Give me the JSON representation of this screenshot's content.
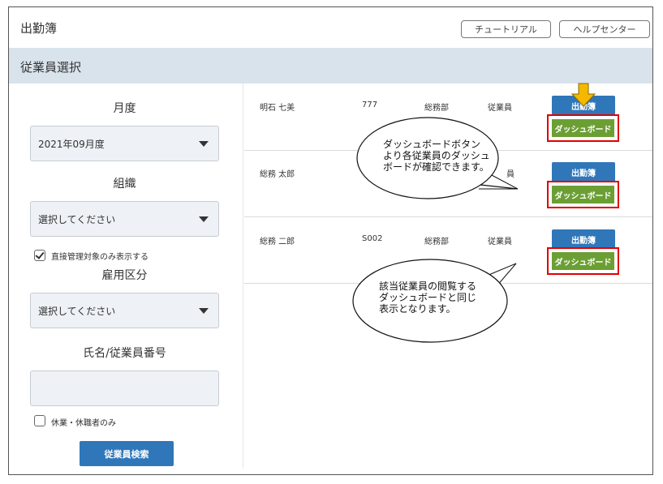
{
  "header": {
    "app_title": "出勤簿",
    "tutorial_label": "チュートリアル",
    "help_label": "ヘルプセンター"
  },
  "section": {
    "title": "従業員選択"
  },
  "filters": {
    "month_label": "月度",
    "month_value": "2021年09月度",
    "org_label": "組織",
    "org_value": "選択してください",
    "direct_only_label": "直接管理対象のみ表示する",
    "direct_only_checked": true,
    "employment_label": "雇用区分",
    "employment_value": "選択してください",
    "name_label": "氏名/従業員番号",
    "name_value": "",
    "leave_only_label": "休業・休職者のみ",
    "leave_only_checked": false,
    "search_button": "従業員検索"
  },
  "employees": [
    {
      "name": "明石 七美",
      "number": "777",
      "department": "総務部",
      "type": "従業員",
      "attendance_button": "出勤簿",
      "dashboard_button": "ダッシュボード"
    },
    {
      "name": "総務 太郎",
      "number": "",
      "department": "",
      "type": "員",
      "attendance_button": "出勤簿",
      "dashboard_button": "ダッシュボード"
    },
    {
      "name": "総務 二郎",
      "number": "S002",
      "department": "総務部",
      "type": "従業員",
      "attendance_button": "出勤簿",
      "dashboard_button": "ダッシュボード"
    }
  ],
  "callouts": [
    {
      "lines": [
        "ダッシュボードボタン",
        "より各従業員のダッシュ",
        "ボードが確認できます。"
      ]
    },
    {
      "lines": [
        "該当従業員の閲覧する",
        "ダッシュボードと同じ",
        "表示となります。"
      ]
    }
  ],
  "colors": {
    "primary_button": "#2f77b9",
    "dashboard_button": "#6b9f34",
    "highlight_border": "#e00000",
    "arrow": "#f5b800",
    "section_bar": "#d9e3ec"
  }
}
